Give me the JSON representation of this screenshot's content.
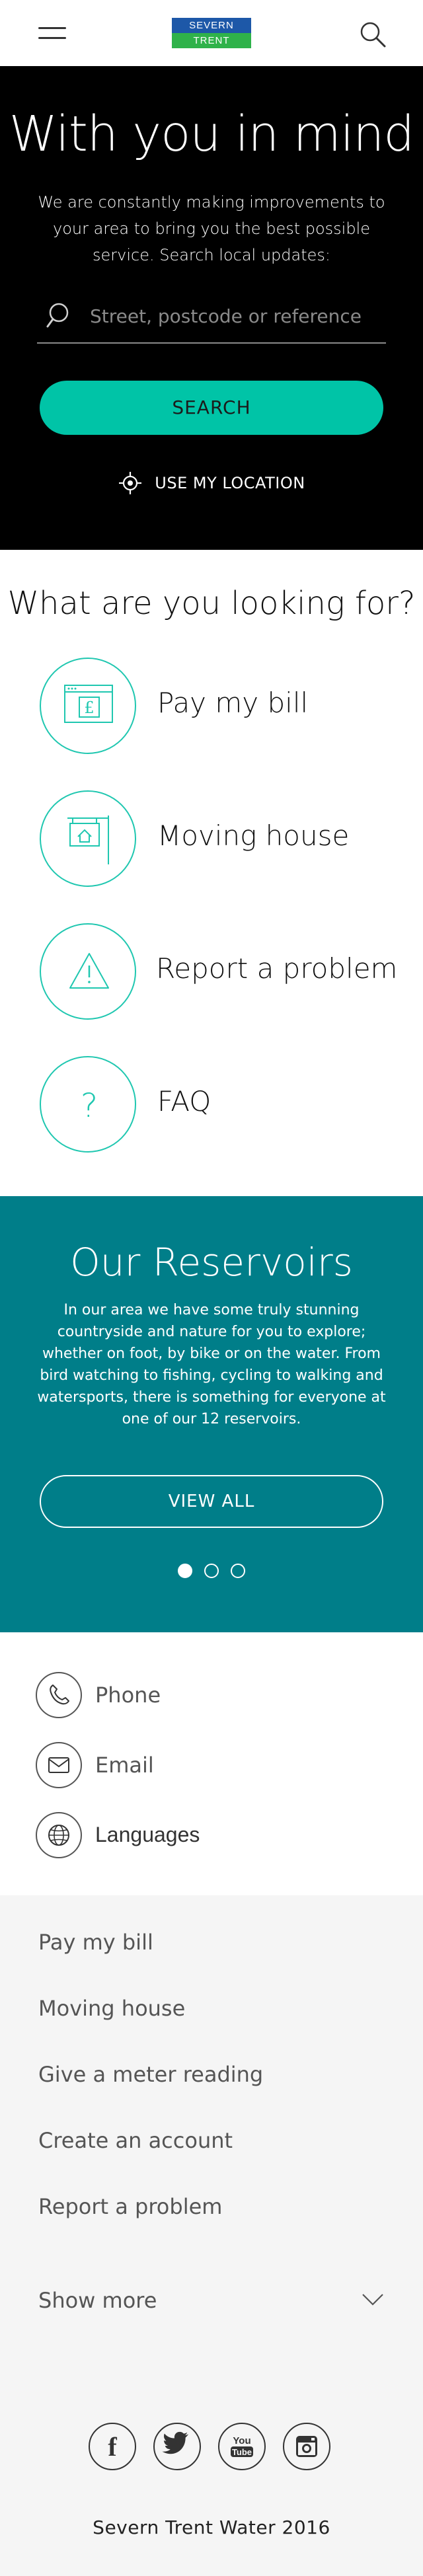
{
  "header": {
    "logo_line1": "SEVERN",
    "logo_line2": "TRENT",
    "logo_colors": {
      "top": "#1d58a8",
      "bottom": "#2fb24a"
    },
    "menu_icon": "hamburger-icon",
    "search_icon": "search-icon"
  },
  "hero": {
    "title": "With you in mind",
    "description": "We are constantly making improvements to your area to bring you the best possible service. Search local updates:",
    "search_placeholder": "Street, postcode or reference",
    "search_value": "",
    "search_button": "SEARCH",
    "location_label": "USE MY LOCATION",
    "accent_color": "#00c4a7"
  },
  "looking_for": {
    "title": "What are you looking for?",
    "items": [
      {
        "label": "Pay my bill",
        "icon": "bill-icon"
      },
      {
        "label": "Moving house",
        "icon": "house-sign-icon"
      },
      {
        "label": "Report a problem",
        "icon": "warning-icon"
      },
      {
        "label": "FAQ",
        "icon": "question-icon"
      }
    ]
  },
  "reservoirs": {
    "title": "Our Reservoirs",
    "description": "In our area we have some truly stunning countryside and nature for you to explore; whether on foot, by bike or on the water. From bird watching to fishing, cycling to walking and watersports, there is something for everyone at one of our 12 reservoirs.",
    "button": "VIEW ALL",
    "slides": 3,
    "active_slide": 1,
    "background_color": "#007e89"
  },
  "contact": {
    "items": [
      {
        "label": "Phone",
        "icon": "phone-icon"
      },
      {
        "label": "Email",
        "icon": "email-icon"
      },
      {
        "label": "Languages",
        "icon": "globe-icon"
      }
    ]
  },
  "footer": {
    "nav": [
      "Pay my bill",
      "Moving house",
      "Give a meter reading",
      "Create an account",
      "Report a problem"
    ],
    "show_more": "Show more",
    "social": [
      {
        "name": "facebook-icon",
        "text": "f"
      },
      {
        "name": "twitter-icon",
        "text": ""
      },
      {
        "name": "youtube-icon",
        "text": "You Tube"
      },
      {
        "name": "instagram-icon",
        "text": ""
      }
    ],
    "copyright": "Severn Trent Water 2016"
  }
}
